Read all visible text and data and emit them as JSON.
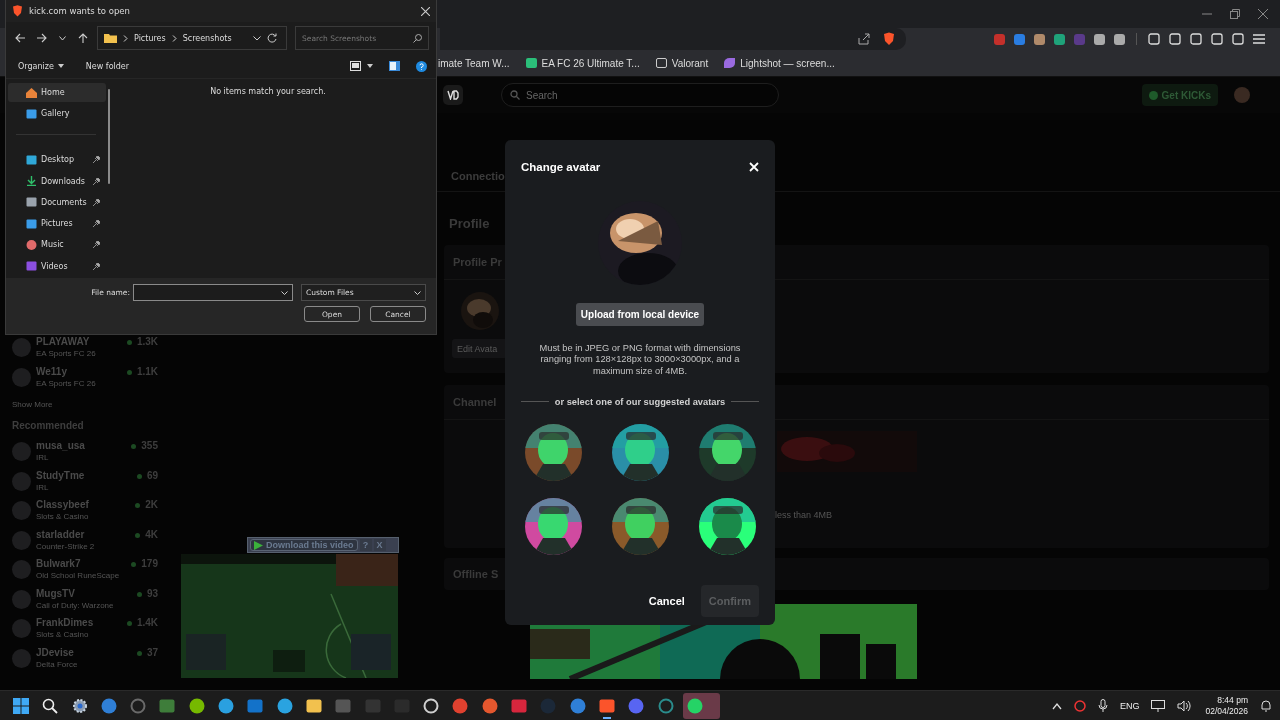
{
  "file_dialog": {
    "title": "kick.com wants to open",
    "path": [
      "Pictures",
      "Screenshots"
    ],
    "search": {
      "placeholder": "Search Screenshots"
    },
    "toolbar": [
      "Organize",
      "New folder"
    ],
    "nav": [
      {
        "label": "Home",
        "kind": "home",
        "selected": true,
        "pinned": false
      },
      {
        "label": "Gallery",
        "kind": "gallery",
        "selected": false,
        "pinned": false
      },
      {
        "label": "Desktop",
        "kind": "desktop",
        "selected": false,
        "pinned": true
      },
      {
        "label": "Downloads",
        "kind": "downloads",
        "selected": false,
        "pinned": true
      },
      {
        "label": "Documents",
        "kind": "documents",
        "selected": false,
        "pinned": true
      },
      {
        "label": "Pictures",
        "kind": "pictures",
        "selected": false,
        "pinned": true
      },
      {
        "label": "Music",
        "kind": "music",
        "selected": false,
        "pinned": true
      },
      {
        "label": "Videos",
        "kind": "videos",
        "selected": false,
        "pinned": true
      }
    ],
    "empty_message": "No items match your search.",
    "file_name_label": "File name:",
    "file_type": "Custom Files",
    "open_button": "Open",
    "cancel_button": "Cancel"
  },
  "browser": {
    "bookmarks": [
      "imate Team W...",
      "EA FC 26 Ultimate T...",
      "Valorant",
      "Lightshot — screen..."
    ]
  },
  "site": {
    "search": {
      "placeholder": "Search"
    },
    "get_kicks": "Get KICKs",
    "following": [
      {
        "name": "PLAYAWAY",
        "category": "EA Sports FC 26",
        "viewers": "1.3K"
      },
      {
        "name": "We11y",
        "category": "EA Sports FC 26",
        "viewers": "1.1K"
      }
    ],
    "show_more": "Show More",
    "recommended_title": "Recommended",
    "recommended": [
      {
        "name": "musa_usa",
        "category": "IRL",
        "viewers": "355"
      },
      {
        "name": "StudyTme",
        "category": "IRL",
        "viewers": "69"
      },
      {
        "name": "Classybeef",
        "category": "Slots & Casino",
        "viewers": "2K"
      },
      {
        "name": "starladder",
        "category": "Counter-Strike 2",
        "viewers": "4K"
      },
      {
        "name": "Bulwark7",
        "category": "Old School RuneScape",
        "viewers": "179"
      },
      {
        "name": "MugsTV",
        "category": "Call of Duty: Warzone",
        "viewers": "93"
      },
      {
        "name": "FrankDimes",
        "category": "Slots & Casino",
        "viewers": "1.4K"
      },
      {
        "name": "JDevise",
        "category": "Delta Force",
        "viewers": "37"
      }
    ],
    "tab": "Connectio",
    "heading": "Profile",
    "profile_panel": {
      "title": "Profile Pr",
      "edit_button": "Edit Avata"
    },
    "channel_panel": {
      "title": "Channel",
      "hint": "less than 4MB"
    },
    "offline_panel": {
      "title": "Offline S"
    }
  },
  "video_overlay": {
    "download_button": "Download this video",
    "help_button": "?",
    "close_button": "X"
  },
  "modal": {
    "title": "Change avatar",
    "upload_button": "Upload from local device",
    "requirements": "Must be in JPEG or PNG format with dimensions ranging from 128×128px to 3000×3000px, and a maximum size of 4MB.",
    "divider_text": "or select one of our suggested avatars",
    "cancel_button": "Cancel",
    "confirm": {
      "label": "Confirm",
      "disabled": true
    }
  },
  "taskbar": {
    "language": "ENG",
    "time": "8:44 pm",
    "date": "02/04/2026"
  }
}
